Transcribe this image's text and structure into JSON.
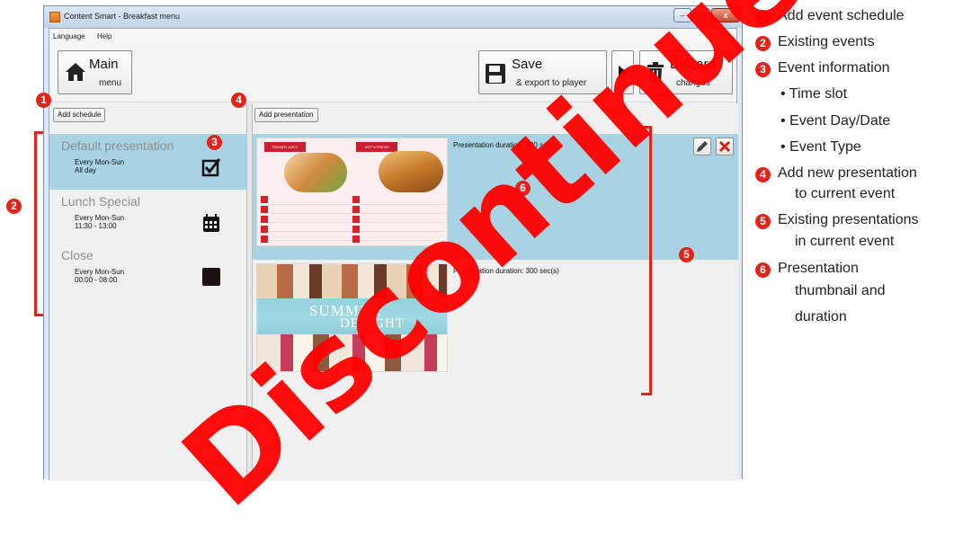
{
  "window": {
    "title": "Content Smart - Breakfast menu",
    "minimize_glyph": "–",
    "maximize_glyph": "□",
    "close_glyph": "x"
  },
  "menu": {
    "language": "Language",
    "help": "Help"
  },
  "toolbar": {
    "main_big": "Main",
    "main_small": "menu",
    "save_big": "Save",
    "save_small": "& export to player",
    "discard_big": "Discard",
    "discard_small": "changes"
  },
  "left": {
    "add_schedule": "Add schedule",
    "events": [
      {
        "name": "Default presentation",
        "days": "Every Mon-Sun",
        "time": "All day",
        "icon": "checkbox-icon"
      },
      {
        "name": "Lunch Special",
        "days": "Every Mon-Sun",
        "time": "11:30 - 13:00",
        "icon": "calendar-icon"
      },
      {
        "name": "Close",
        "days": "Every Mon-Sun",
        "time": "00:00 - 08:00",
        "icon": "black-square-icon"
      }
    ]
  },
  "right": {
    "add_presentation": "Add presentation",
    "presentations": [
      {
        "duration": "Presentation duration: 300 sec(s)",
        "thumb_text_1": "TENDER JUICY CHICKEN",
        "thumb_text_2": "HOT'N FRESH CROISSANT"
      },
      {
        "duration": "Presentation duration: 300 sec(s)",
        "thumb_text_1": "SUMMER",
        "thumb_text_2": "DELIGHT"
      }
    ]
  },
  "legend": {
    "items": [
      {
        "n": "1",
        "text": "Add event schedule"
      },
      {
        "n": "2",
        "text": "Existing events"
      },
      {
        "n": "3",
        "text": "Event information"
      },
      {
        "b": "Time slot"
      },
      {
        "b": "Event Day/Date"
      },
      {
        "b": "Event Type"
      },
      {
        "n": "4",
        "text": "Add new presentation"
      },
      {
        "c": "to current event"
      },
      {
        "n": "5",
        "text": "Existing presentations"
      },
      {
        "c": "in current event"
      },
      {
        "n": "6",
        "text": "Presentation"
      },
      {
        "c": "thumbnail and"
      },
      {
        "c": "duration"
      }
    ]
  },
  "markers": {
    "m1": "1",
    "m2": "2",
    "m3": "3",
    "m4": "4",
    "m5": "5",
    "m6": "6"
  },
  "watermark": "Discontinued",
  "colors": {
    "accent_red": "#e2231a",
    "selected_bg": "#a7d3e3"
  }
}
